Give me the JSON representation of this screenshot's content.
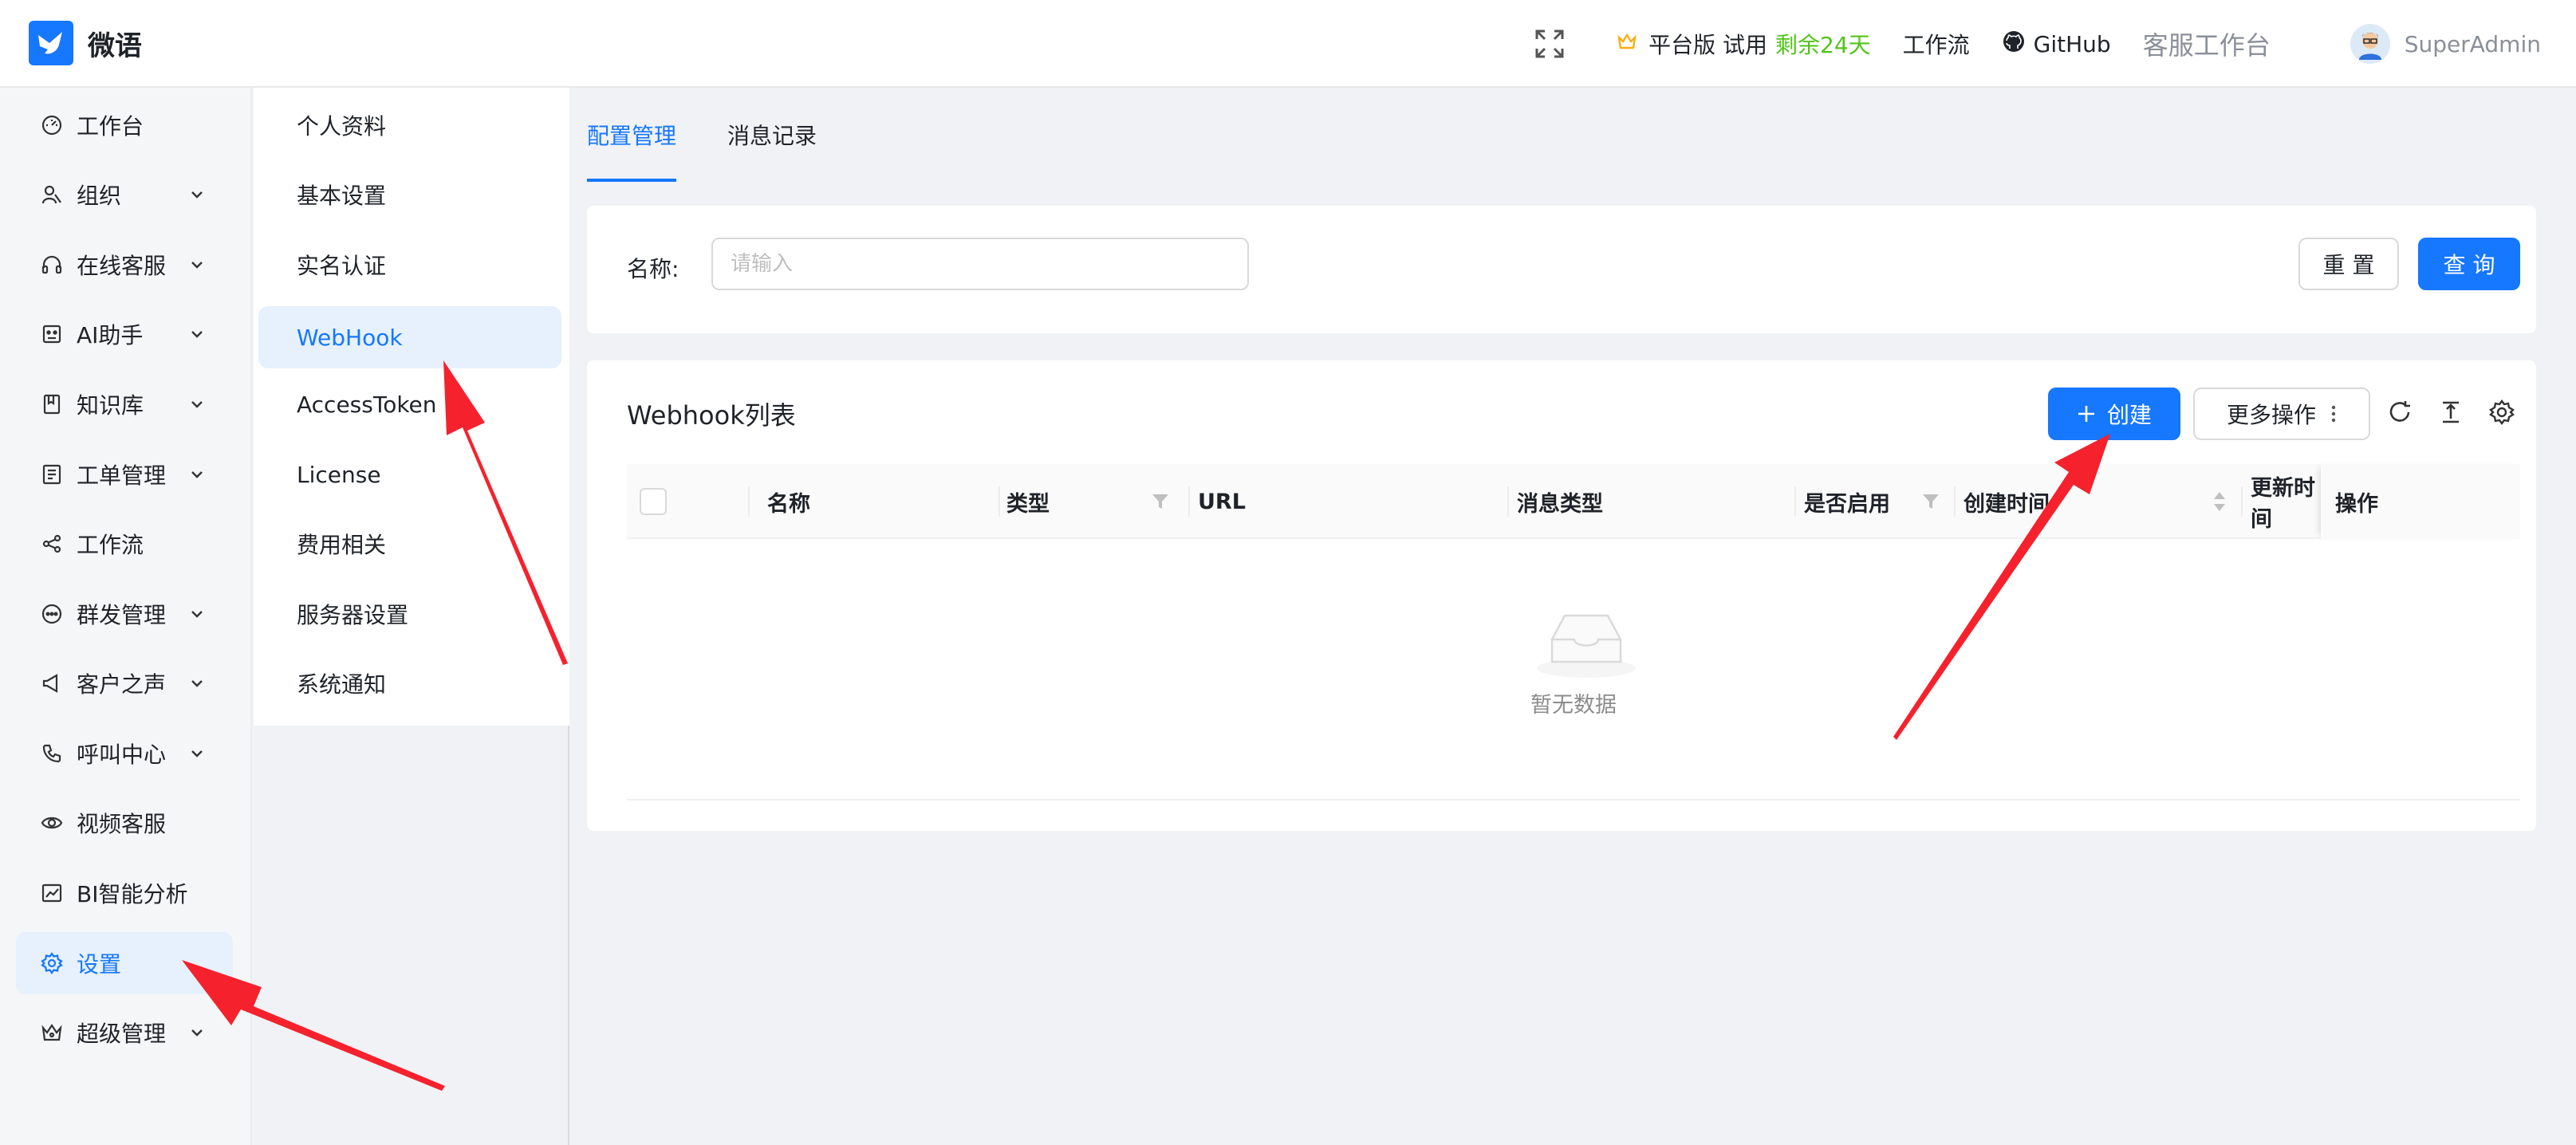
{
  "header": {
    "app_name": "微语",
    "plan_label": "平台版 试用",
    "trial_remaining": "剩余24天",
    "workflow_link": "工作流",
    "github_link": "GitHub",
    "agent_workbench": "客服工作台",
    "username": "SuperAdmin"
  },
  "left_menu": [
    {
      "label": "工作台",
      "icon": "dashboard-icon",
      "has_children": false
    },
    {
      "label": "组织",
      "icon": "organization-icon",
      "has_children": true
    },
    {
      "label": "在线客服",
      "icon": "headset-icon",
      "has_children": true
    },
    {
      "label": "AI助手",
      "icon": "robot-icon",
      "has_children": true
    },
    {
      "label": "知识库",
      "icon": "book-icon",
      "has_children": true
    },
    {
      "label": "工单管理",
      "icon": "ticket-icon",
      "has_children": true
    },
    {
      "label": "工作流",
      "icon": "share-icon",
      "has_children": false
    },
    {
      "label": "群发管理",
      "icon": "chat-icon",
      "has_children": true
    },
    {
      "label": "客户之声",
      "icon": "megaphone-icon",
      "has_children": true
    },
    {
      "label": "呼叫中心",
      "icon": "phone-icon",
      "has_children": true
    },
    {
      "label": "视频客服",
      "icon": "eye-icon",
      "has_children": false
    },
    {
      "label": "BI智能分析",
      "icon": "chart-icon",
      "has_children": false
    },
    {
      "label": "设置",
      "icon": "gear-icon",
      "has_children": false,
      "active": true
    },
    {
      "label": "超级管理",
      "icon": "crown-icon",
      "has_children": true
    }
  ],
  "sub_menu": [
    {
      "label": "个人资料"
    },
    {
      "label": "基本设置"
    },
    {
      "label": "实名认证"
    },
    {
      "label": "WebHook",
      "active": true
    },
    {
      "label": "AccessToken"
    },
    {
      "label": "License"
    },
    {
      "label": "费用相关"
    },
    {
      "label": "服务器设置"
    },
    {
      "label": "系统通知"
    }
  ],
  "tabs": [
    {
      "label": "配置管理",
      "active": true
    },
    {
      "label": "消息记录"
    }
  ],
  "search": {
    "name_label": "名称:",
    "name_placeholder": "请输入",
    "name_value": "",
    "reset_label": "重 置",
    "query_label": "查 询"
  },
  "table": {
    "title": "Webhook列表",
    "create_label": "创建",
    "more_label": "更多操作",
    "columns": [
      "名称",
      "类型",
      "URL",
      "消息类型",
      "是否启用",
      "创建时间",
      "更新时间",
      "操作"
    ],
    "rows": [],
    "empty_text": "暂无数据"
  },
  "colors": {
    "accent": "#1677ff",
    "trial_green": "#52c41a",
    "annotation_arrow": "#f5222d"
  }
}
